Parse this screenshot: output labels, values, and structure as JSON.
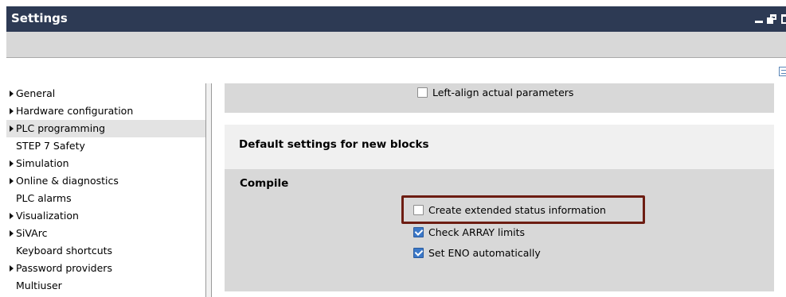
{
  "window": {
    "title": "Settings"
  },
  "nav": {
    "items": [
      {
        "label": "General",
        "expandable": true,
        "selected": false
      },
      {
        "label": "Hardware configuration",
        "expandable": true,
        "selected": false
      },
      {
        "label": "PLC programming",
        "expandable": true,
        "selected": true
      },
      {
        "label": "STEP 7 Safety",
        "expandable": false,
        "selected": false
      },
      {
        "label": "Simulation",
        "expandable": true,
        "selected": false
      },
      {
        "label": "Online & diagnostics",
        "expandable": true,
        "selected": false
      },
      {
        "label": "PLC alarms",
        "expandable": false,
        "selected": false
      },
      {
        "label": "Visualization",
        "expandable": true,
        "selected": false
      },
      {
        "label": "SiVArc",
        "expandable": true,
        "selected": false
      },
      {
        "label": "Keyboard shortcuts",
        "expandable": false,
        "selected": false
      },
      {
        "label": "Password providers",
        "expandable": true,
        "selected": false
      },
      {
        "label": "Multiuser",
        "expandable": false,
        "selected": false
      }
    ]
  },
  "content": {
    "top_option": {
      "label": "Left-align actual parameters",
      "checked": false
    },
    "section_title": "Default settings for new blocks",
    "compile": {
      "title": "Compile",
      "options": [
        {
          "label": "Create extended status information",
          "checked": false,
          "highlighted": true
        },
        {
          "label": "Check ARRAY limits",
          "checked": true,
          "highlighted": false
        },
        {
          "label": "Set ENO automatically",
          "checked": true,
          "highlighted": false
        }
      ]
    }
  },
  "colors": {
    "titlebar": "#2d3a54",
    "panel": "#d8d8d8",
    "checkbox_checked": "#3b78c8",
    "highlight": "#6d1d12"
  }
}
